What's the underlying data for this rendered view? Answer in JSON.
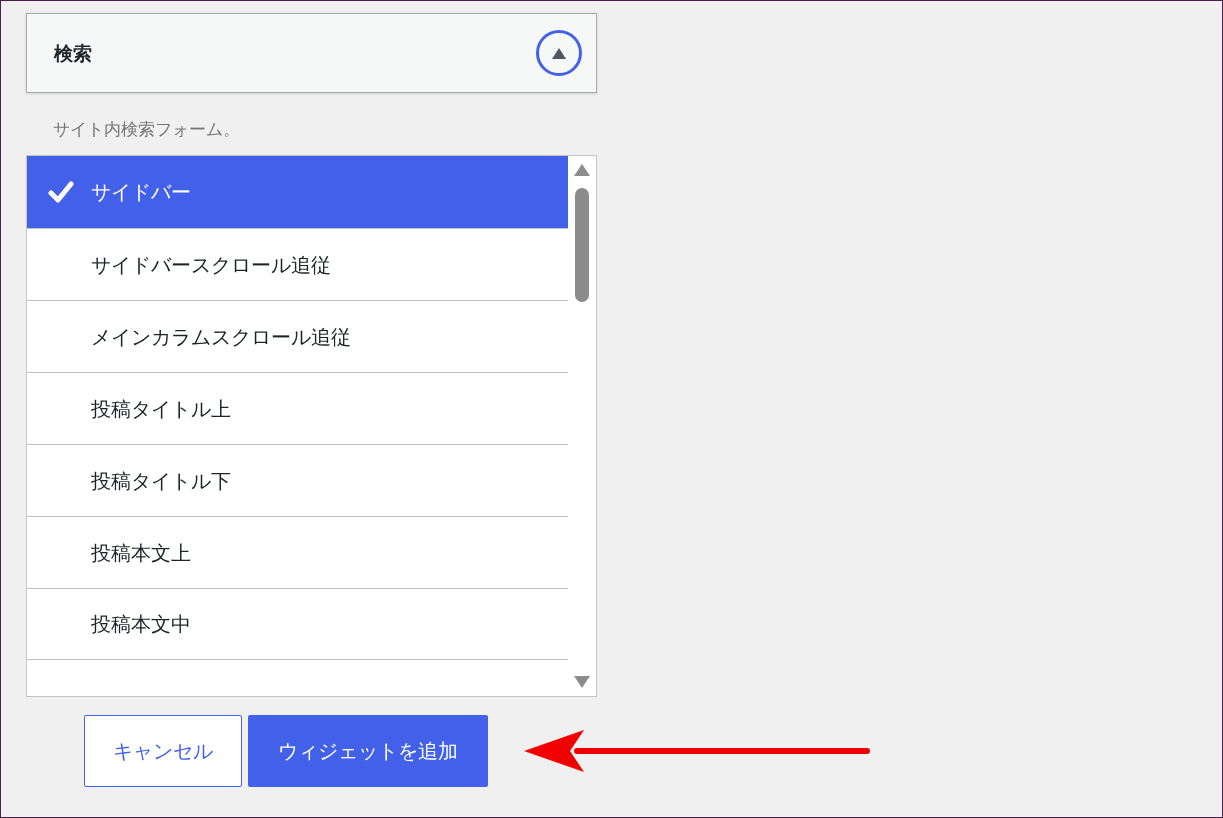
{
  "panel": {
    "title": "検索",
    "expanded": true
  },
  "description": "サイト内検索フォーム。",
  "areas": [
    {
      "label": "サイドバー",
      "selected": true
    },
    {
      "label": "サイドバースクロール追従",
      "selected": false
    },
    {
      "label": "メインカラムスクロール追従",
      "selected": false
    },
    {
      "label": "投稿タイトル上",
      "selected": false
    },
    {
      "label": "投稿タイトル下",
      "selected": false
    },
    {
      "label": "投稿本文上",
      "selected": false
    },
    {
      "label": "投稿本文中",
      "selected": false
    }
  ],
  "buttons": [
    {
      "label": "キャンセル",
      "kind": "secondary"
    },
    {
      "label": "ウィジェットを追加",
      "kind": "primary"
    }
  ]
}
